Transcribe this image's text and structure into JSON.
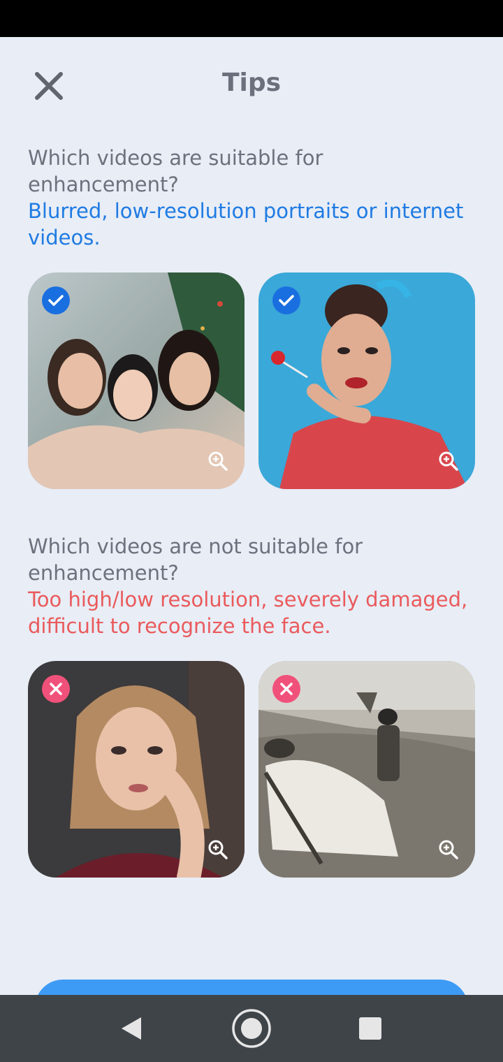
{
  "header": {
    "title": "Tips"
  },
  "suitable": {
    "question": "Which videos are suitable for enhancement?",
    "answer": "Blurred, low-resolution portraits or internet videos.",
    "images": [
      {
        "name": "group-selfie-photo",
        "badge": "check-icon"
      },
      {
        "name": "lollipop-portrait-photo",
        "badge": "check-icon"
      }
    ]
  },
  "unsuitable": {
    "question": "Which videos are not suitable for enhancement?",
    "answer": "Too high/low resolution, severely damaged, difficult to recognize the face.",
    "images": [
      {
        "name": "blonde-portrait-photo",
        "badge": "x-icon"
      },
      {
        "name": "vintage-beach-photo",
        "badge": "x-icon"
      }
    ]
  },
  "colors": {
    "background": "#e8edf6",
    "title": "#6c707c",
    "good_answer": "#1f7be2",
    "bad_answer": "#ea5a5c",
    "check_badge": "#1a6fe0",
    "x_badge": "#f0517a",
    "button": "#3e9bf5"
  },
  "navigation": {
    "icons": [
      "back-icon",
      "home-icon",
      "recents-icon"
    ]
  }
}
